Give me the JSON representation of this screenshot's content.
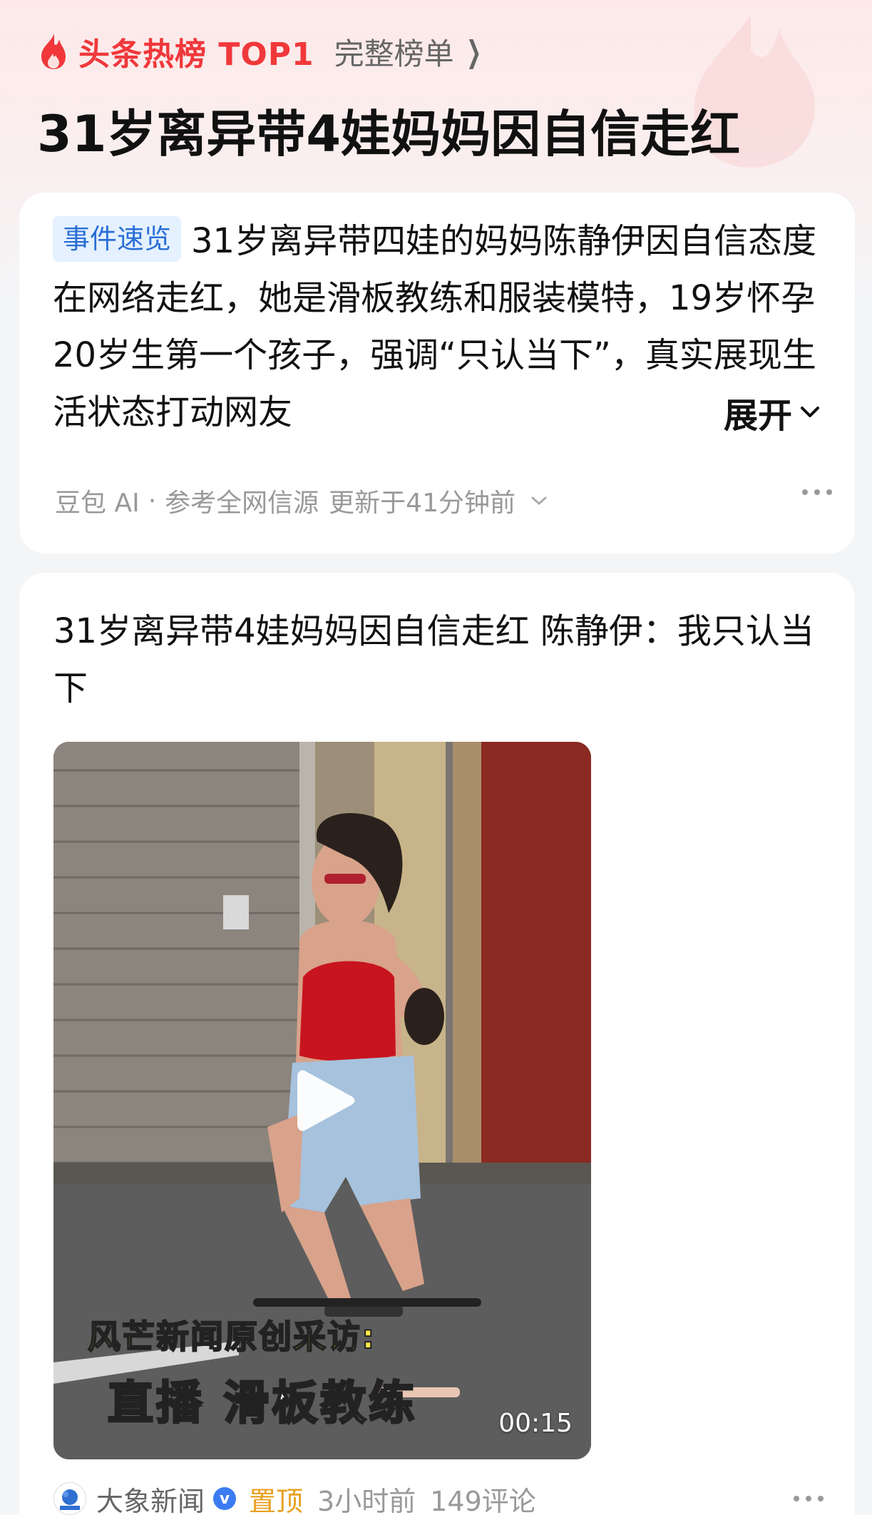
{
  "header": {
    "hot_label": "头条热榜 TOP1",
    "full_list_label": "完整榜单",
    "title": "31岁离异带4娃妈妈因自信走红",
    "accent_color": "#f0383b"
  },
  "summary": {
    "tag": "事件速览",
    "text": "31岁离异带四娃的妈妈陈静伊因自信态度在网络走红，她是滑板教练和服装模特，19岁怀孕20岁生第一个孩子，强调“只认当下”，真实展现生活状态打动网友",
    "expand_label": "展开",
    "source": "豆包 AI",
    "source_note": "参考全网信源",
    "updated": "更新于41分钟前"
  },
  "article": {
    "title": "31岁离异带4娃妈妈因自信走红 陈静伊：我只认当下",
    "video": {
      "caption_line1": "风芒新闻原创采访:",
      "caption_line2": "直播 滑板教练",
      "duration": "00:15"
    },
    "publisher": "大象新闻",
    "pinned_label": "置顶",
    "time": "3小时前",
    "comments": "149评论",
    "pinned_color": "#e8a020"
  }
}
